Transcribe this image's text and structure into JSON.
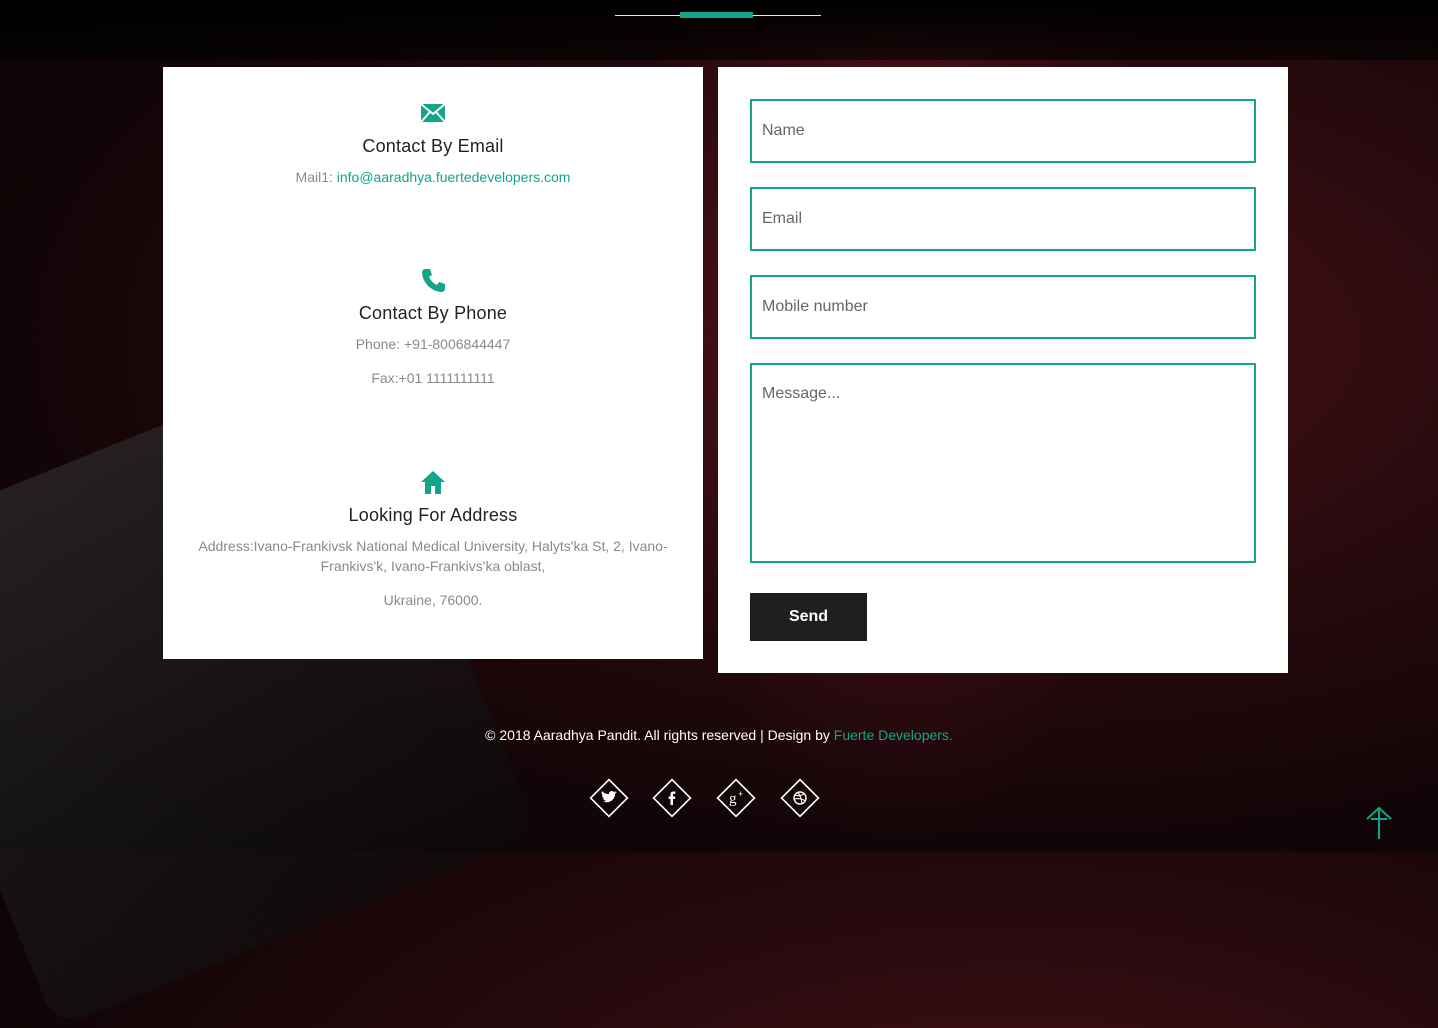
{
  "contact_info": {
    "email": {
      "icon": "envelope-icon",
      "title": "Contact By Email",
      "mail_label": "Mail1: ",
      "mail_value": "info@aaradhya.fuertedevelopers.com"
    },
    "phone": {
      "icon": "phone-icon",
      "title": "Contact By Phone",
      "phone_line": "Phone: +91-8006844447",
      "fax_line": "Fax:+01 1111111111"
    },
    "address": {
      "icon": "home-icon",
      "title": "Looking For Address",
      "address_line": "Address:Ivano-Frankivsk National Medical University, Halyts'ka St, 2, Ivano-Frankivs'k, Ivano-Frankivs'ka oblast,",
      "country_line": "Ukraine, 76000."
    }
  },
  "form": {
    "name_placeholder": "Name",
    "email_placeholder": "Email",
    "mobile_placeholder": "Mobile number",
    "message_placeholder": "Message...",
    "send_label": "Send"
  },
  "footer": {
    "copyright": "© 2018 Aaradhya Pandit. All rights reserved | Design by ",
    "designer": "Fuerte Developers."
  },
  "social": [
    "twitter-icon",
    "facebook-icon",
    "google-plus-icon",
    "dribbble-icon"
  ],
  "colors": {
    "accent": "#13a589",
    "button_bg": "#1f1f1f"
  }
}
